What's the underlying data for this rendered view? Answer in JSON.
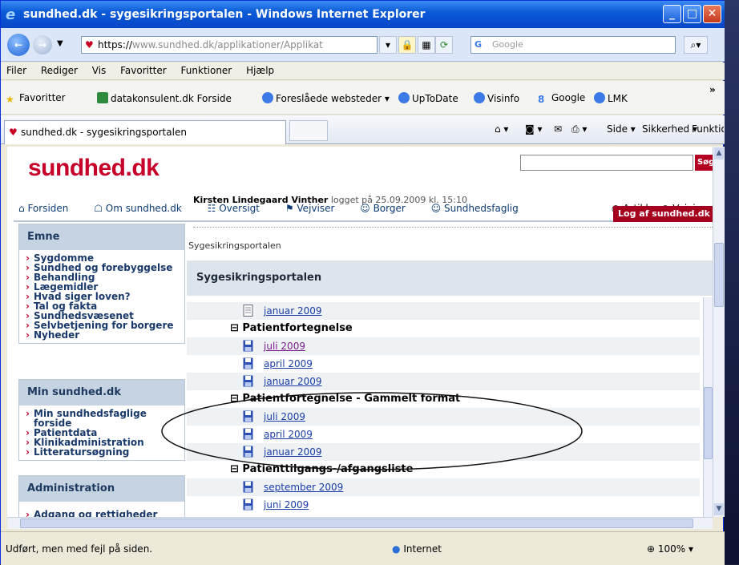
{
  "window": {
    "title": "sundhed.dk - sygesikringsportalen - Windows Internet Explorer"
  },
  "address": {
    "url_https": "https://",
    "url_rest": "www.sundhed.dk/applikationer/Applikat",
    "search_placeholder": "Google"
  },
  "menu": [
    "Filer",
    "Rediger",
    "Vis",
    "Favoritter",
    "Funktioner",
    "Hjælp"
  ],
  "favorites": {
    "label": "Favoritter",
    "items": [
      "datakonsulent.dk Forside",
      "Foreslåede websteder ▾",
      "UpToDate",
      "Visinfo",
      "Google",
      "LMK"
    ]
  },
  "tab": {
    "label": "sundhed.dk - sygesikringsportalen"
  },
  "commandbar": {
    "side": "Side ▾",
    "sikkerhed": "Sikkerhed ▾",
    "funktioner": "Funktioner ▾"
  },
  "site": {
    "logo": "sundhed.dk",
    "search_button": "Søg",
    "topnav": [
      "Forsiden",
      "Om sundhed.dk",
      "Oversigt",
      "Vejviser",
      "Borger",
      "Sundhedsfaglig"
    ],
    "radio_artikler": "Artikler",
    "radio_vejvis": "Vejvis",
    "user_name": "Kirsten Lindegaard Vinther",
    "user_status": "logget på 25.09.2009 kl. 15:10",
    "logout": "Log af sundhed.dk",
    "breadcrumb": "Sygesikringsportalen",
    "panel_title": "Sygesikringsportalen"
  },
  "sidebar": {
    "emne": {
      "title": "Emne",
      "items": [
        "Sygdomme",
        "Sundhed og forebyggelse",
        "Behandling",
        "Lægemidler",
        "Hvad siger loven?",
        "Tal og fakta",
        "Sundhedsvæsenet",
        "Selvbetjening for borgere",
        "Nyheder"
      ]
    },
    "min": {
      "title": "Min sundhed.dk",
      "items": [
        "Min sundhedsfaglige forside",
        "Patientdata",
        "Klinikadministration",
        "Litteratursøgning"
      ]
    },
    "admin": {
      "title": "Administration",
      "items": [
        "Adgang og rettigheder"
      ]
    }
  },
  "listing": {
    "top_link": "januar 2009",
    "group1": {
      "header": "Patientfortegnelse",
      "links": [
        "juli 2009",
        "april 2009",
        "januar 2009"
      ]
    },
    "group2": {
      "header": "Patientfortegnelse - Gammelt format",
      "links": [
        "juli 2009",
        "april 2009",
        "januar 2009"
      ]
    },
    "group3": {
      "header": "Patienttilgangs-/afgangsliste",
      "links": [
        "september 2009",
        "juni 2009"
      ]
    }
  },
  "status": {
    "message": "Udført, men med fejl på siden.",
    "zone": "Internet",
    "zoom": "100%"
  },
  "colors": {
    "brand": "#c6002a",
    "link": "#1a3ca8",
    "titlebar": "#0b5bd8"
  }
}
